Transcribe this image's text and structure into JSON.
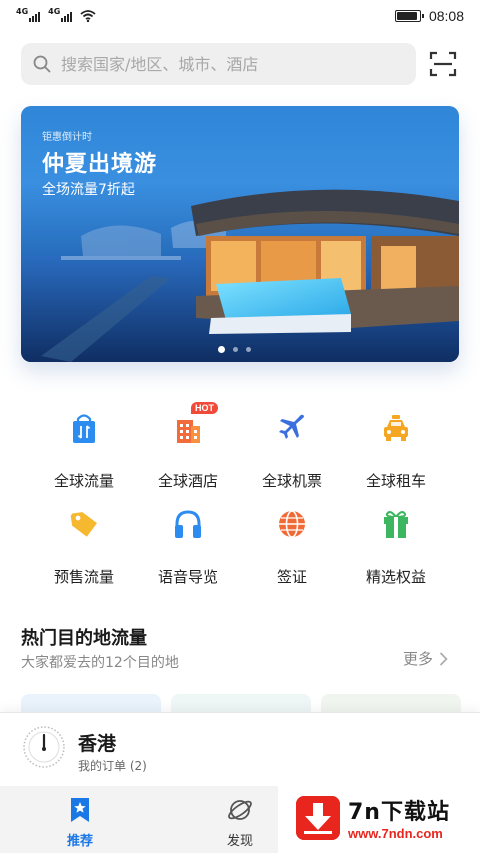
{
  "status_bar": {
    "sim1_label": "4G",
    "sim2_label": "4G",
    "time": "08:08",
    "battery_level_pct": 90,
    "icons": [
      "signal-icon",
      "signal-icon",
      "wifi-icon",
      "battery-icon"
    ]
  },
  "search": {
    "placeholder": "搜索国家/地区、城市、酒店",
    "value": "",
    "icons": [
      "search-icon",
      "scan-icon"
    ]
  },
  "banner": {
    "countdown_label": "钜惠倒计时",
    "headline": "仲夏出境游",
    "subline": "全场流量7折起",
    "slide_count": 3,
    "active_slide": 1
  },
  "services": [
    {
      "label": "全球流量",
      "icon": "shopping-bag-icon",
      "color": "#2d8cf0"
    },
    {
      "label": "全球酒店",
      "icon": "hotel-icon",
      "color": "#f26b3a",
      "badge": "HOT"
    },
    {
      "label": "全球机票",
      "icon": "airplane-icon",
      "color": "#3b6fe0"
    },
    {
      "label": "全球租车",
      "icon": "taxi-icon",
      "color": "#f5a623"
    },
    {
      "label": "预售流量",
      "icon": "tag-icon",
      "color": "#f5b82e"
    },
    {
      "label": "语音导览",
      "icon": "headphones-icon",
      "color": "#2d8cf0"
    },
    {
      "label": "签证",
      "icon": "globe-icon",
      "color": "#f06a35"
    },
    {
      "label": "精选权益",
      "icon": "gift-icon",
      "color": "#3cb760"
    }
  ],
  "destinations": {
    "title": "热门目的地流量",
    "subtitle": "大家都爱去的12个目的地",
    "more_label": "更多"
  },
  "order_bar": {
    "city": "香港",
    "orders_label": "我的订单 (2)"
  },
  "bottom_nav": {
    "tabs": [
      {
        "label": "推荐",
        "icon": "star-bookmark-icon",
        "active": true
      },
      {
        "label": "发现",
        "icon": "planet-icon",
        "active": false
      }
    ]
  },
  "watermark": {
    "brand": "7n下载站",
    "url": "www.7ndn.com"
  },
  "colors": {
    "accent": "#1a78e6",
    "hot_badge": "#f04a3a",
    "watermark_red": "#e8261e"
  }
}
